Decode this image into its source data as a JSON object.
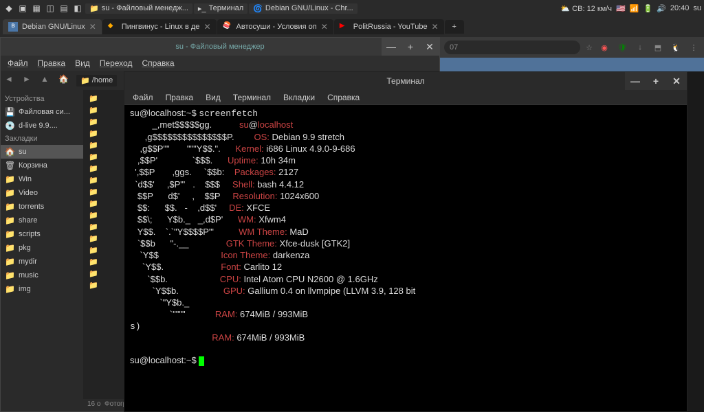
{
  "taskbar": {
    "items": [
      {
        "label": "su - Файловый менедж..."
      },
      {
        "label": "Терминал"
      },
      {
        "label": "Debian GNU/Linux - Chr..."
      }
    ],
    "weather": "СВ: 12 км/ч",
    "clock": "20:40",
    "user": "su"
  },
  "browser": {
    "tabs": [
      {
        "label": "Debian GNU/Linux",
        "active": true,
        "color": "#4a76a8"
      },
      {
        "label": "Пингвинус - Linux в де",
        "color": "#fa0"
      },
      {
        "label": "Автосуши - Условия оп",
        "color": "#fff"
      },
      {
        "label": "PolitRussia - YouTube",
        "color": "#f00"
      }
    ],
    "url": "07"
  },
  "filemanager": {
    "title": "su - Файловый менеджер",
    "menu": [
      "Файл",
      "Правка",
      "Вид",
      "Переход",
      "Справка"
    ],
    "path": "/home",
    "devices_hdr": "Устройства",
    "devices": [
      {
        "label": "Файловая си..."
      },
      {
        "label": "d-live 9.9...."
      }
    ],
    "bookmarks_hdr": "Закладки",
    "bookmarks": [
      {
        "label": "su",
        "icon": "🏠",
        "active": true
      },
      {
        "label": "Корзина",
        "icon": "🗑"
      },
      {
        "label": "Win",
        "icon": "📁"
      },
      {
        "label": "Video",
        "icon": "📁"
      },
      {
        "label": "torrents",
        "icon": "📁"
      },
      {
        "label": "share",
        "icon": "📁"
      },
      {
        "label": "scripts",
        "icon": "📁"
      },
      {
        "label": "pkg",
        "icon": "📁"
      },
      {
        "label": "mydir",
        "icon": "📁"
      },
      {
        "label": "music",
        "icon": "📁"
      },
      {
        "label": "img",
        "icon": "📁"
      }
    ],
    "status_count": "16 о",
    "status": "Фотографии на стен"
  },
  "terminal": {
    "title": "Терминал",
    "menu": [
      "Файл",
      "Правка",
      "Вид",
      "Терминал",
      "Вкладки",
      "Справка"
    ],
    "prompt": "su@localhost:~$ ",
    "command": "screenfetch",
    "ascii": [
      "         _,met$$$$$gg.           ",
      "      ,g$$$$$$$$$$$$$$$P.        ",
      "    ,g$$P\"\"       \"\"\"Y$$.\".      ",
      "   ,$$P'              `$$$.      ",
      "  ',$$P       ,ggs.     `$$b:    ",
      "  `d$$'     ,$P\"'   .    $$$     ",
      "   $$P      d$'     ,    $$P     ",
      "   $$:      $$.   -    ,d$$'     ",
      "   $$\\;      Y$b._   _,d$P'      ",
      "   Y$$.    `.`\"Y$$$$P\"'          ",
      "   `$$b      \"-.__               ",
      "    `Y$$                         ",
      "     `Y$$.                       ",
      "       `$$b.                     ",
      "         `Y$$b.                  ",
      "            `\"Y$b._              ",
      "                `\"\"\"\"            "
    ],
    "info": [
      [
        "su",
        "@",
        "localhost"
      ],
      [
        "OS:",
        " Debian 9.9 stretch"
      ],
      [
        "Kernel:",
        " i686 Linux 4.9.0-9-686"
      ],
      [
        "Uptime:",
        " 10h 34m"
      ],
      [
        "Packages:",
        " 2127"
      ],
      [
        "Shell:",
        " bash 4.4.12"
      ],
      [
        "Resolution:",
        " 1024x600"
      ],
      [
        "DE:",
        " XFCE"
      ],
      [
        "WM:",
        " Xfwm4"
      ],
      [
        "WM Theme:",
        " MaD"
      ],
      [
        "GTK Theme:",
        " Xfce-dusk [GTK2]"
      ],
      [
        "Icon Theme:",
        " darkenza"
      ],
      [
        "Font:",
        " Carlito 12"
      ],
      [
        "CPU:",
        " Intel Atom CPU N2600 @ 1.6GHz"
      ],
      [
        "GPU:",
        " Gallium 0.4 on llvmpipe (LLVM 3.9, 128 bit"
      ],
      [
        "",
        ""
      ],
      [
        "RAM:",
        " 674MiB / 993MiB"
      ]
    ],
    "gpu_wrap": "s)"
  }
}
